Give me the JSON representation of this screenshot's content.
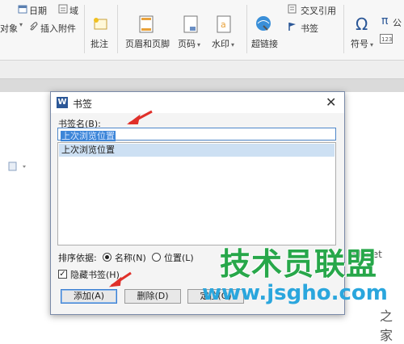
{
  "ribbon": {
    "date": "日期",
    "field": "域",
    "object": "对象",
    "attachment": "插入附件",
    "comment": "批注",
    "header_footer": "页眉和页脚",
    "page_number": "页码",
    "watermark": "水印",
    "hyperlink": "超链接",
    "cross_ref": "交叉引用",
    "bookmark": "书签",
    "symbol": "符号",
    "formula_pi": "π",
    "formula_label": "公"
  },
  "dialog": {
    "logo": "W",
    "title": "书签",
    "name_label": "书签名(B):",
    "name_value": "上次浏览位置",
    "list_items": [
      "上次浏览位置"
    ],
    "sort_label": "排序依据:",
    "sort_name": "名称(N)",
    "sort_position": "位置(L)",
    "hidden_label": "隐藏书签(H)",
    "add_button": "添加(A)",
    "delete_button": "删除(D)",
    "goto_button": "定位(G)"
  },
  "watermark": {
    "brand": "技术员联盟",
    "url": "www.jsgho.com",
    "fragment": "51.net",
    "corner": "之家"
  }
}
